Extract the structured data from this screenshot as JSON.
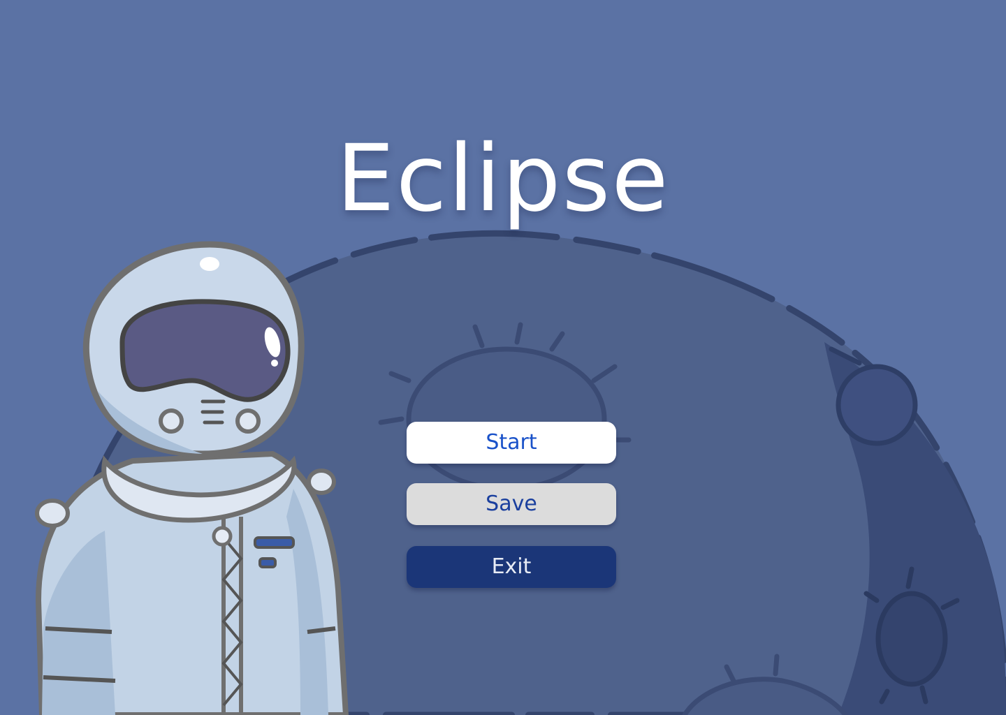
{
  "game": {
    "title": "Eclipse"
  },
  "menu": {
    "start_label": "Start",
    "save_label": "Save",
    "exit_label": "Exit"
  },
  "colors": {
    "background": "#5b72a4",
    "moon": "#4f628c",
    "moon_shadow": "#3a4b77",
    "start_button_bg": "#ffffff",
    "save_button_bg": "#dcdcdc",
    "exit_button_bg": "#1b3678",
    "button_text": "#1a52c9"
  },
  "illustration": {
    "background_object": "moon-with-craters",
    "character": "astronaut"
  }
}
